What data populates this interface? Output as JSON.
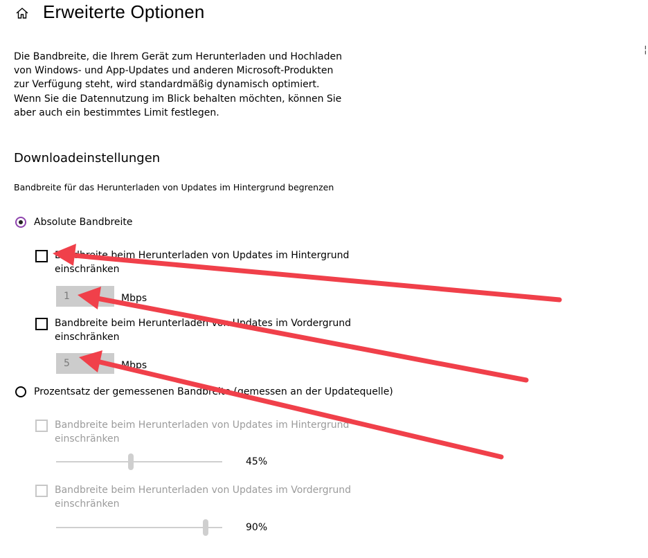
{
  "header": {
    "title": "Erweiterte Optionen",
    "home_icon": "home-icon"
  },
  "description": {
    "lines": [
      "Die Bandbreite, die Ihrem Gerät zum Herunterladen und Hochladen",
      "von Windows- und App-Updates und anderen Microsoft-Produkten",
      "zur Verfügung steht, wird standardmäßig dynamisch optimiert.",
      "Wenn Sie die Datennutzung im Blick behalten möchten, können Sie",
      "aber auch ein bestimmtes Limit festlegen."
    ]
  },
  "download": {
    "section_title": "Downloadeinstellungen",
    "subtitle": "Bandbreite für das Herunterladen von Updates im Hintergrund begrenzen",
    "absolute": {
      "label": "Absolute Bandbreite",
      "selected": true,
      "background": {
        "line1": "Bandbreite beim Herunterladen von Updates im Hintergrund",
        "line2": "einschränken",
        "checked": false,
        "value": "1",
        "unit": "Mbps"
      },
      "foreground": {
        "line1": "Bandbreite beim Herunterladen von Updates im Vordergrund",
        "line2": "einschränken",
        "checked": false,
        "value": "5",
        "unit": "Mbps"
      }
    },
    "percentage": {
      "label": "Prozentsatz der gemessenen Bandbreite (gemessen an der Updatequelle)",
      "selected": false,
      "background": {
        "line1": "Bandbreite beim Herunterladen von Updates im Hintergrund",
        "line2": "einschränken",
        "checked": false,
        "percent": 45,
        "value_label": "45%"
      },
      "foreground": {
        "line1": "Bandbreite beim Herunterladen von Updates im Vordergrund",
        "line2": "einschränken",
        "checked": false,
        "percent": 90,
        "value_label": "90%"
      }
    }
  },
  "annotations": {
    "arrow_color": "#f0404a"
  },
  "colors": {
    "radio_accent": "#8e44ad",
    "disabled_text": "#9b9b9b",
    "disabled_control": "#cccccc"
  }
}
